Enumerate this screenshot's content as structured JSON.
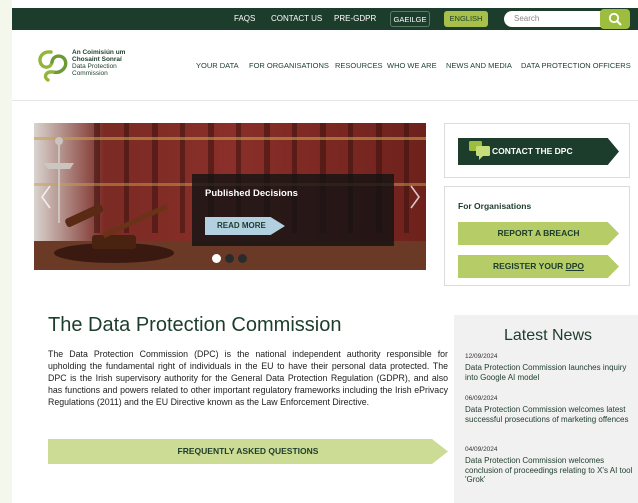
{
  "topbar": {
    "links": [
      "FAQS",
      "CONTACT US",
      "PRE-GDPR"
    ],
    "lang_ga": "GAEILGE",
    "lang_en": "ENGLISH",
    "search_placeholder": "Search"
  },
  "logo": {
    "line1": "An Coimisiún um",
    "line2": "Chosaint Sonraí",
    "line3": "Data Protection",
    "line4": "Commission"
  },
  "nav": [
    "YOUR DATA",
    "FOR ORGANISATIONS",
    "RESOURCES",
    "WHO WE ARE",
    "NEWS AND MEDIA",
    "DATA PROTECTION OFFICERS"
  ],
  "hero": {
    "slide_title": "Published Decisions",
    "read_more": "READ MORE",
    "active_slide": 1,
    "slide_count": 3
  },
  "sidebar": {
    "contact_label": "CONTACT THE DPC",
    "section_title": "For Organisations",
    "report_breach": "REPORT A BREACH",
    "register_prefix": "REGISTER YOUR ",
    "register_dpo": "DPO"
  },
  "main": {
    "title": "The Data Protection Commission",
    "body": "The Data Protection Commission (DPC) is the national independent authority responsible for upholding the fundamental right of individuals in the EU to have their personal data protected. The DPC is the Irish supervisory authority for the General Data Protection Regulation (GDPR), and also has functions and powers related to other important regulatory frameworks including the Irish ePrivacy Regulations (2011) and the EU Directive known as the Law Enforcement Directive.",
    "faq_label": "FREQUENTLY ASKED QUESTIONS"
  },
  "news": {
    "title": "Latest News",
    "items": [
      {
        "date": "12/09/2024",
        "title": "Data Protection Commission launches inquiry into Google AI model"
      },
      {
        "date": "06/09/2024",
        "title": "Data Protection Commission welcomes latest successful prosecutions of marketing offences"
      },
      {
        "date": "04/09/2024",
        "title": "Data Protection Commission welcomes conclusion of proceedings relating to X's AI tool 'Grok'"
      }
    ]
  },
  "colors": {
    "dark_green": "#1d3d2c",
    "lime": "#b5cc67",
    "faq_bg": "#cddc95",
    "read_more_bg": "#b2d0e0"
  }
}
